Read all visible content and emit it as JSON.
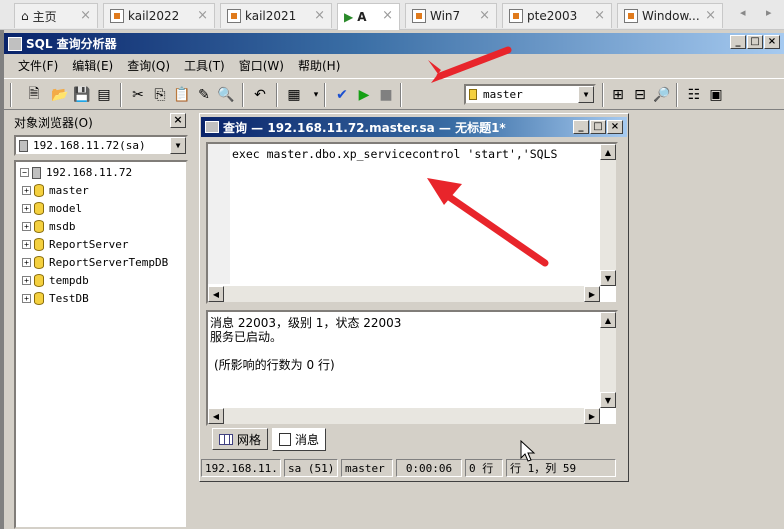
{
  "browser_tabs": [
    {
      "label": "主页"
    },
    {
      "label": "kail2022"
    },
    {
      "label": "kail2021"
    },
    {
      "label": "A"
    },
    {
      "label": "Win7"
    },
    {
      "label": "pte2003"
    },
    {
      "label": "Window..."
    }
  ],
  "app": {
    "title": "SQL 查询分析器",
    "min": "_",
    "max": "□",
    "close": "×"
  },
  "menu": [
    "文件(F)",
    "编辑(E)",
    "查询(Q)",
    "工具(T)",
    "窗口(W)",
    "帮助(H)"
  ],
  "toolbar": {
    "database": "master"
  },
  "object_browser": {
    "title": "对象浏览器(O)",
    "server_combo": "192.168.11.72(sa)",
    "server": "192.168.11.72",
    "databases": [
      "master",
      "model",
      "msdb",
      "ReportServer",
      "ReportServerTempDB",
      "tempdb",
      "TestDB"
    ]
  },
  "query_window": {
    "title": "查询 — 192.168.11.72.master.sa — 无标题1*",
    "code": "exec master.dbo.xp_servicecontrol 'start','SQLS",
    "results": [
      "消息 22003，级别 1，状态 22003",
      "服务已启动。",
      "",
      "(所影响的行数为 0 行)"
    ],
    "tabs": {
      "grid": "网格",
      "messages": "消息"
    },
    "status": {
      "server": "192.168.11.",
      "user": "sa (51)",
      "db": "master",
      "time": "0:00:06",
      "rows": "0 行",
      "position": "行 1，列 59"
    }
  },
  "colors": {
    "accent_arrow": "#e8252b",
    "title_start": "#0a246a",
    "title_end": "#a6caf0"
  }
}
